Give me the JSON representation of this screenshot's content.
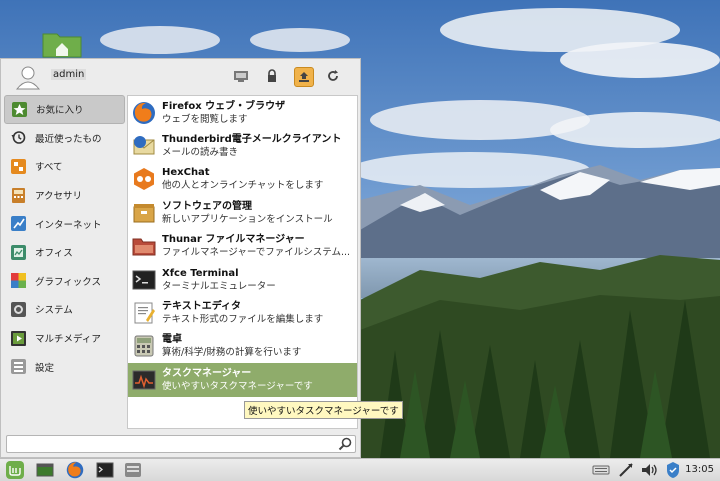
{
  "user": {
    "name": "admin"
  },
  "header_buttons": [
    {
      "name": "computer-icon"
    },
    {
      "name": "lock-icon"
    },
    {
      "name": "logout-icon"
    },
    {
      "name": "power-icon"
    }
  ],
  "categories": [
    {
      "label": "お気に入り",
      "icon": "star-icon",
      "selected": true
    },
    {
      "label": "最近使ったもの",
      "icon": "history-icon"
    },
    {
      "label": "すべて",
      "icon": "all-apps-icon"
    },
    {
      "label": "アクセサリ",
      "icon": "accessories-icon"
    },
    {
      "label": "インターネット",
      "icon": "internet-icon"
    },
    {
      "label": "オフィス",
      "icon": "office-icon"
    },
    {
      "label": "グラフィックス",
      "icon": "graphics-icon"
    },
    {
      "label": "システム",
      "icon": "system-icon"
    },
    {
      "label": "マルチメディア",
      "icon": "multimedia-icon"
    },
    {
      "label": "設定",
      "icon": "settings-icon"
    }
  ],
  "apps": [
    {
      "name": "Firefox ウェブ・ブラウザ",
      "desc": "ウェブを閲覧します",
      "icon": "firefox-icon"
    },
    {
      "name": "Thunderbird電子メールクライアント",
      "desc": "メールの読み書き",
      "icon": "thunderbird-icon"
    },
    {
      "name": "HexChat",
      "desc": "他の人とオンラインチャットをします",
      "icon": "hexchat-icon"
    },
    {
      "name": "ソフトウェアの管理",
      "desc": "新しいアプリケーションをインストール",
      "icon": "software-manager-icon"
    },
    {
      "name": "Thunar ファイルマネージャー",
      "desc": "ファイルマネージャーでファイルシステム...",
      "icon": "thunar-icon"
    },
    {
      "name": "Xfce Terminal",
      "desc": "ターミナルエミュレーター",
      "icon": "terminal-icon"
    },
    {
      "name": "テキストエディタ",
      "desc": "テキスト形式のファイルを編集します",
      "icon": "text-editor-icon"
    },
    {
      "name": "電卓",
      "desc": "算術/科学/財務の計算を行います",
      "icon": "calculator-icon"
    },
    {
      "name": "タスクマネージャー",
      "desc": "使いやすいタスクマネージャーです",
      "icon": "task-manager-icon",
      "hover": true
    }
  ],
  "search": {
    "value": "",
    "placeholder": ""
  },
  "tooltip": "使いやすいタスクマネージャーです",
  "taskbar": {
    "clock": "13:05"
  },
  "colors": {
    "hover": "#8fac6b",
    "menu_bg": "#ececec",
    "tooltip_bg": "#fff8c0"
  }
}
